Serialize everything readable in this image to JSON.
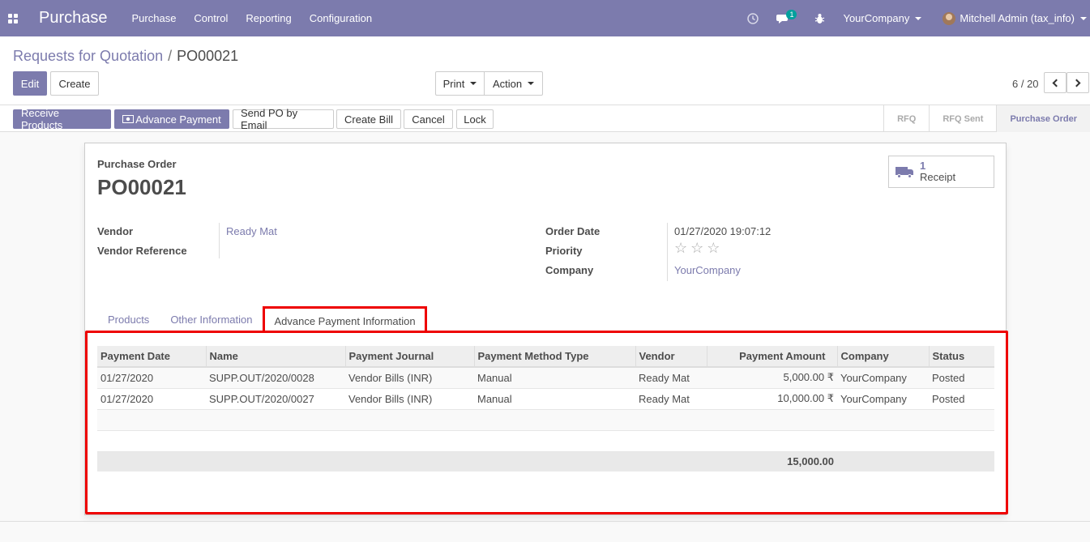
{
  "navbar": {
    "brand": "Purchase",
    "menu": [
      "Purchase",
      "Control",
      "Reporting",
      "Configuration"
    ],
    "message_count": "1",
    "company": "YourCompany",
    "user": "Mitchell Admin (tax_info)"
  },
  "breadcrumb": {
    "parent": "Requests for Quotation",
    "separator": "/",
    "current": "PO00021"
  },
  "toolbar": {
    "edit": "Edit",
    "create": "Create",
    "print": "Print",
    "action": "Action"
  },
  "pager": {
    "value": "6 / 20"
  },
  "status_buttons": {
    "receive": "Receive Products",
    "advance": "Advance Payment",
    "send": "Send PO by Email",
    "bill": "Create Bill",
    "cancel": "Cancel",
    "lock": "Lock"
  },
  "stages": [
    "RFQ",
    "RFQ Sent",
    "Purchase Order"
  ],
  "active_stage": "Purchase Order",
  "form": {
    "doc_label": "Purchase Order",
    "doc_name": "PO00021",
    "smart_button": {
      "count": "1",
      "label": "Receipt"
    },
    "vendor_label": "Vendor",
    "vendor_value": "Ready Mat",
    "vendor_ref_label": "Vendor Reference",
    "order_date_label": "Order Date",
    "order_date_value": "01/27/2020 19:07:12",
    "priority_label": "Priority",
    "priority_stars": 0,
    "company_label": "Company",
    "company_value": "YourCompany"
  },
  "tabs": [
    "Products",
    "Other Information",
    "Advance Payment Information"
  ],
  "payments": {
    "columns": [
      "Payment Date",
      "Name",
      "Payment Journal",
      "Payment Method Type",
      "Vendor",
      "Payment Amount",
      "Company",
      "Status"
    ],
    "rows": [
      [
        "01/27/2020",
        "SUPP.OUT/2020/0028",
        "Vendor Bills (INR)",
        "Manual",
        "Ready Mat",
        "5,000.00 ₹",
        "YourCompany",
        "Posted"
      ],
      [
        "01/27/2020",
        "SUPP.OUT/2020/0027",
        "Vendor Bills (INR)",
        "Manual",
        "Ready Mat",
        "10,000.00 ₹",
        "YourCompany",
        "Posted"
      ]
    ],
    "total": "15,000.00"
  },
  "colors": {
    "brand": "#7c7bad",
    "highlight": "#e00000"
  }
}
